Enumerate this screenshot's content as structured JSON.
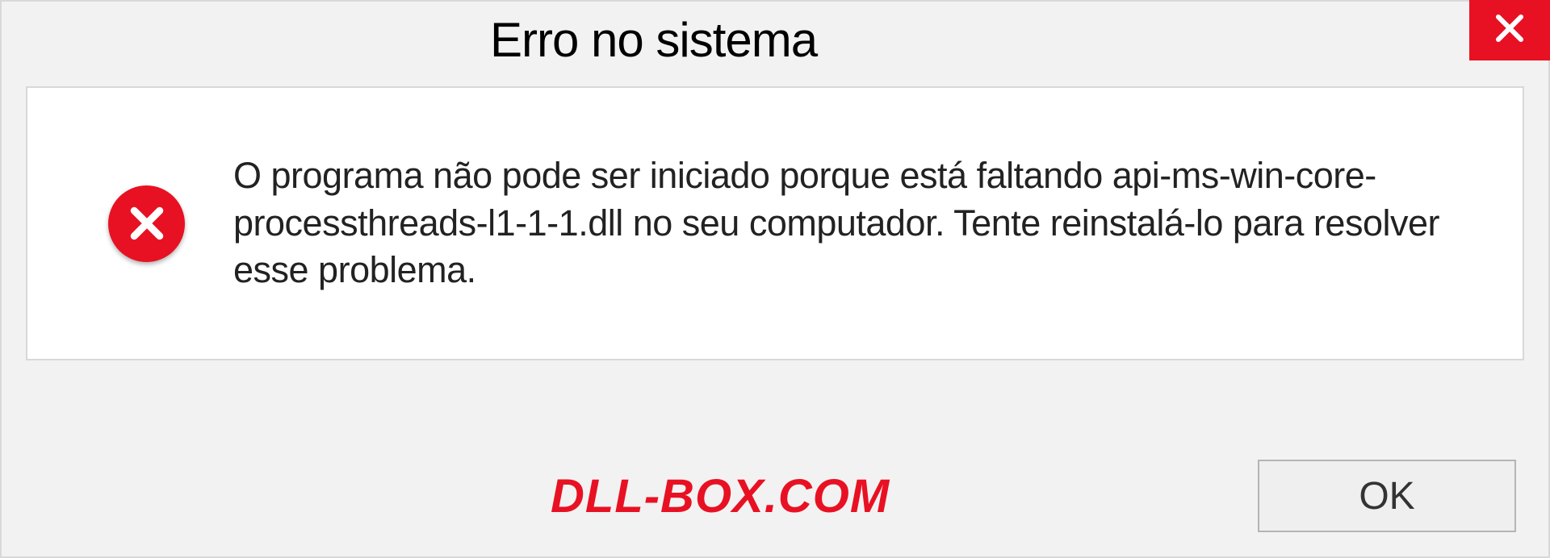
{
  "titlebar": {
    "title": "Erro no sistema"
  },
  "dialog": {
    "message": "O programa não pode ser iniciado porque está faltando api-ms-win-core-processthreads-l1-1-1.dll no seu computador. Tente reinstalá-lo para resolver esse problema."
  },
  "footer": {
    "watermark": "DLL-BOX.COM",
    "ok_label": "OK"
  },
  "icons": {
    "close": "close-icon",
    "error": "error-icon"
  }
}
